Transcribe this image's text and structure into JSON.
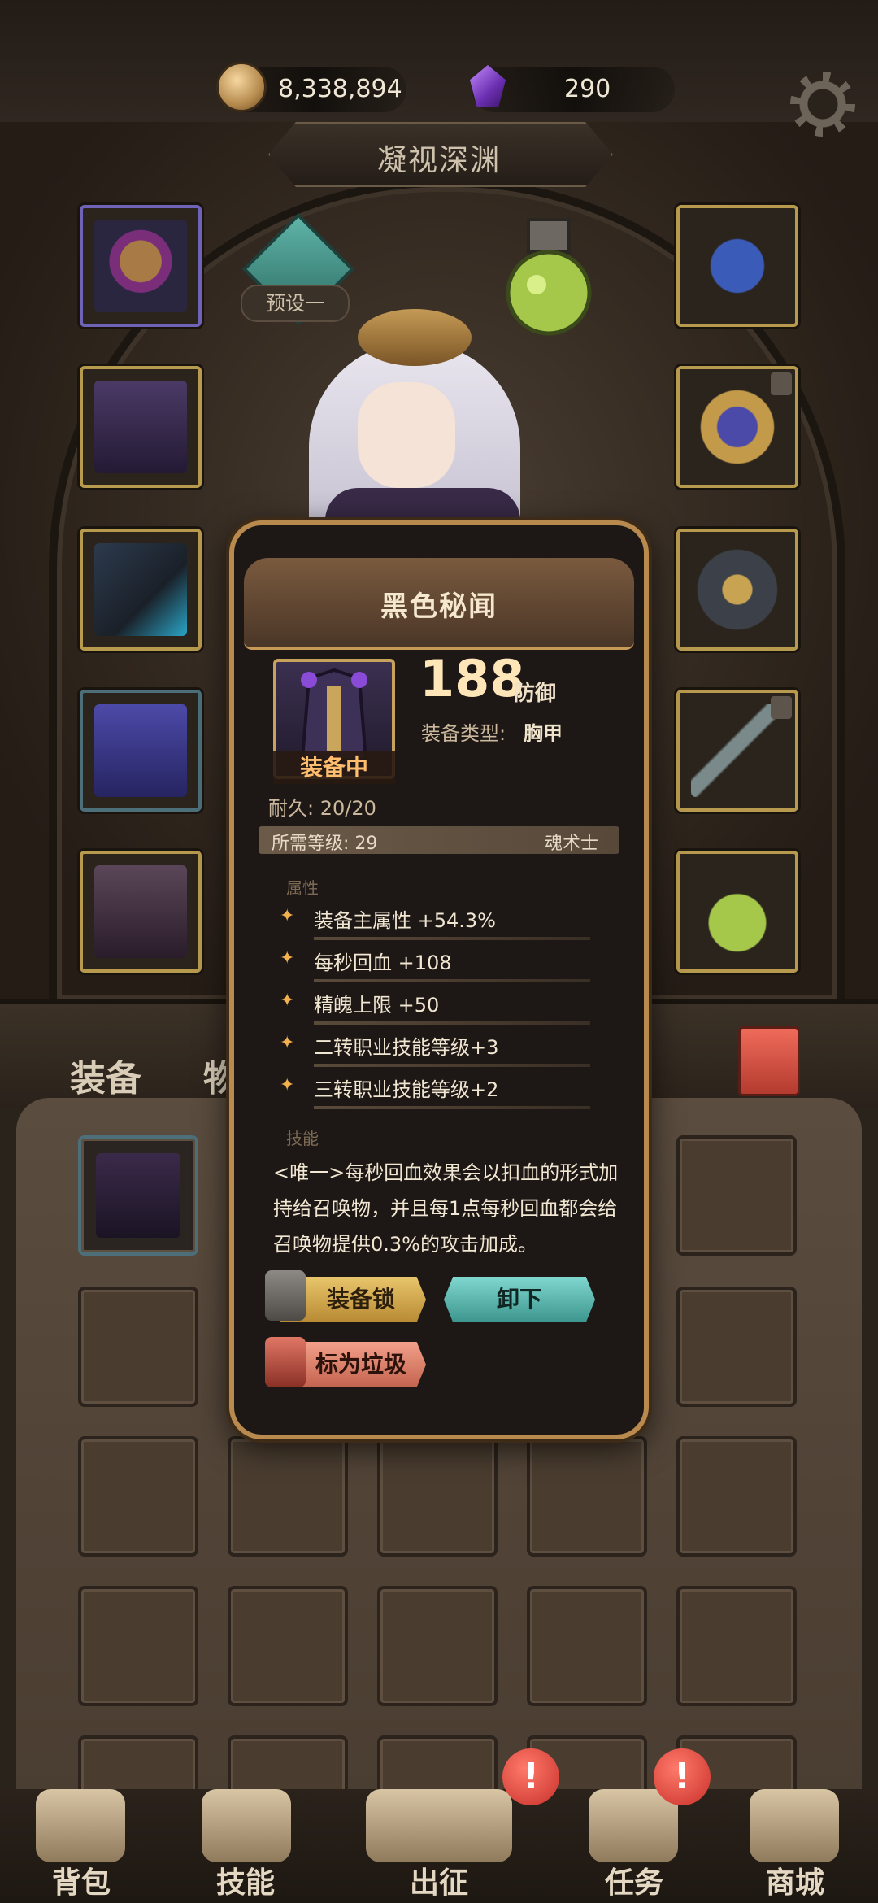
{
  "resources": {
    "gold": "8,338,894",
    "gems": "290"
  },
  "title": "凝视深渊",
  "preset": {
    "label": "预设一"
  },
  "tabs": {
    "equipment": "装备",
    "items": "物品"
  },
  "item_popup": {
    "name": "黑色秘闻",
    "status": "装备中",
    "stat_value": "188",
    "stat_unit": "防御",
    "type_label": "装备类型:",
    "type_value": "胸甲",
    "durability": "耐久: 20/20",
    "required_level": "所需等级: 29",
    "class": "魂术士",
    "attributes_heading": "属性",
    "attributes": [
      "装备主属性 +54.3%",
      "每秒回血 +108",
      "精魄上限 +50",
      "二转职业技能等级+3",
      "三转职业技能等级+2"
    ],
    "skill_heading": "技能",
    "skill_text": "<唯一>每秒回血效果会以扣血的形式加持给召唤物，并且每1点每秒回血都会给召唤物提供0.3%的攻击加成。",
    "buttons": {
      "lock": "装备锁",
      "unequip": "卸下",
      "mark_junk": "标为垃圾"
    }
  },
  "nav": [
    {
      "label": "背包"
    },
    {
      "label": "技能"
    },
    {
      "label": "出征"
    },
    {
      "label": "任务"
    },
    {
      "label": "商城"
    }
  ],
  "colors": {
    "accent_gold": "#b98a4d",
    "unequip_teal": "#3d968e",
    "junk_red": "#c3634f",
    "lock_yellow": "#b88a34"
  }
}
